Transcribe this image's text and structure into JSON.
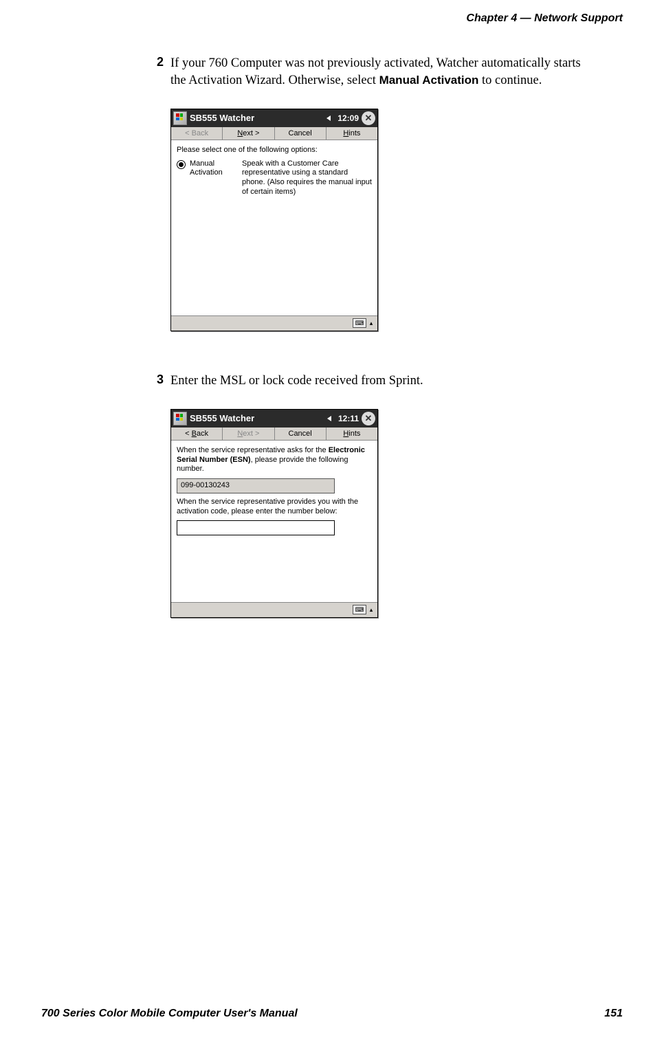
{
  "header": {
    "text": "Chapter  4  —  Network Support"
  },
  "footer": {
    "left": "700 Series Color Mobile Computer User's Manual",
    "right": "151"
  },
  "steps": {
    "s2": {
      "num": "2",
      "text_a": "If your 760 Computer was not previously activated, Watcher automatically starts the Activation Wizard. Otherwise, select ",
      "bold": "Manual Activation",
      "text_b": " to continue."
    },
    "s3": {
      "num": "3",
      "text": "Enter the MSL or lock code received from Sprint."
    }
  },
  "shot1": {
    "title": "SB555 Watcher",
    "time": "12:09",
    "close": "✕",
    "btn_back": "< Back",
    "btn_next_u": "N",
    "btn_next_rest": "ext >",
    "btn_cancel": "Cancel",
    "btn_hints_u": "H",
    "btn_hints_rest": "ints",
    "prompt": "Please select one of the following options:",
    "opt_label_l1": "Manual",
    "opt_label_l2": "Activation",
    "opt_desc": "Speak with a Customer Care representative using a standard phone.  (Also requires the manual input of certain items)",
    "kbd": "⌨"
  },
  "shot2": {
    "title": "SB555 Watcher",
    "time": "12:11",
    "close": "✕",
    "btn_back_u": "B",
    "btn_back_pre": "< ",
    "btn_back_rest": "ack",
    "btn_next_u": "N",
    "btn_next_rest": "ext >",
    "btn_cancel": "Cancel",
    "btn_hints_u": "H",
    "btn_hints_rest": "ints",
    "para1_a": "When the service representative asks for the ",
    "para1_bold": "Electronic Serial Number (ESN)",
    "para1_b": ", please provide the following number.",
    "esn": "099-00130243",
    "para2": "When the service representative provides you with the activation code, please enter the number below:",
    "input_value": "",
    "kbd": "⌨"
  }
}
